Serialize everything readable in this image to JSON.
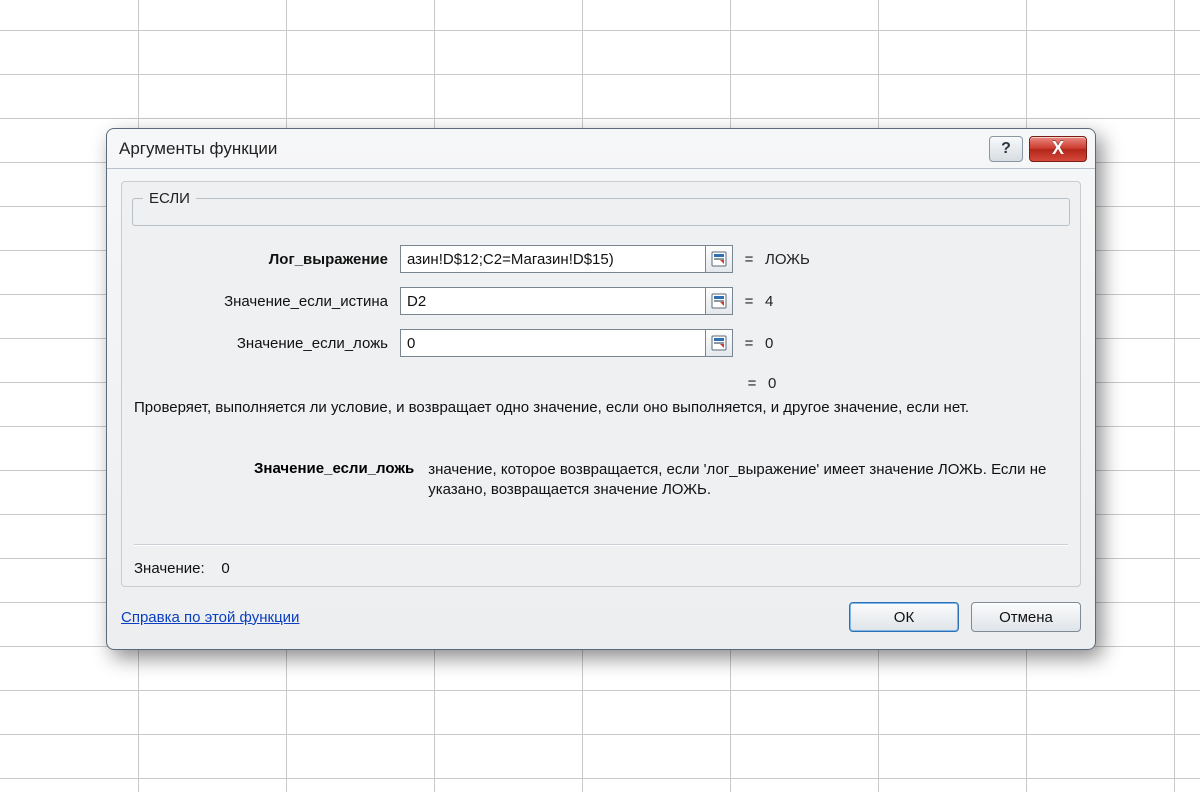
{
  "dialog": {
    "title": "Аргументы функции",
    "function_name": "ЕСЛИ",
    "args": [
      {
        "label": "Лог_выражение",
        "bold": true,
        "value": "азин!D$12;C2=Магазин!D$15)",
        "result": "ЛОЖЬ"
      },
      {
        "label": "Значение_если_истина",
        "bold": false,
        "value": "D2",
        "result": "4"
      },
      {
        "label": "Значение_если_ложь",
        "bold": false,
        "value": "0",
        "result": "0"
      }
    ],
    "equals_sign": "=",
    "formula_result_preview": "0",
    "description": "Проверяет, выполняется ли условие, и возвращает одно значение, если оно выполняется, и другое значение, если нет.",
    "arg_help": {
      "name": "Значение_если_ложь",
      "text": "значение, которое возвращается, если 'лог_выражение' имеет значение ЛОЖЬ. Если не указано, возвращается значение ЛОЖЬ."
    },
    "value_label": "Значение:",
    "value_result": "0",
    "help_link": "Справка по этой функции",
    "ok_label": "ОК",
    "cancel_label": "Отмена",
    "help_button_label": "?",
    "close_button_label": "X"
  }
}
